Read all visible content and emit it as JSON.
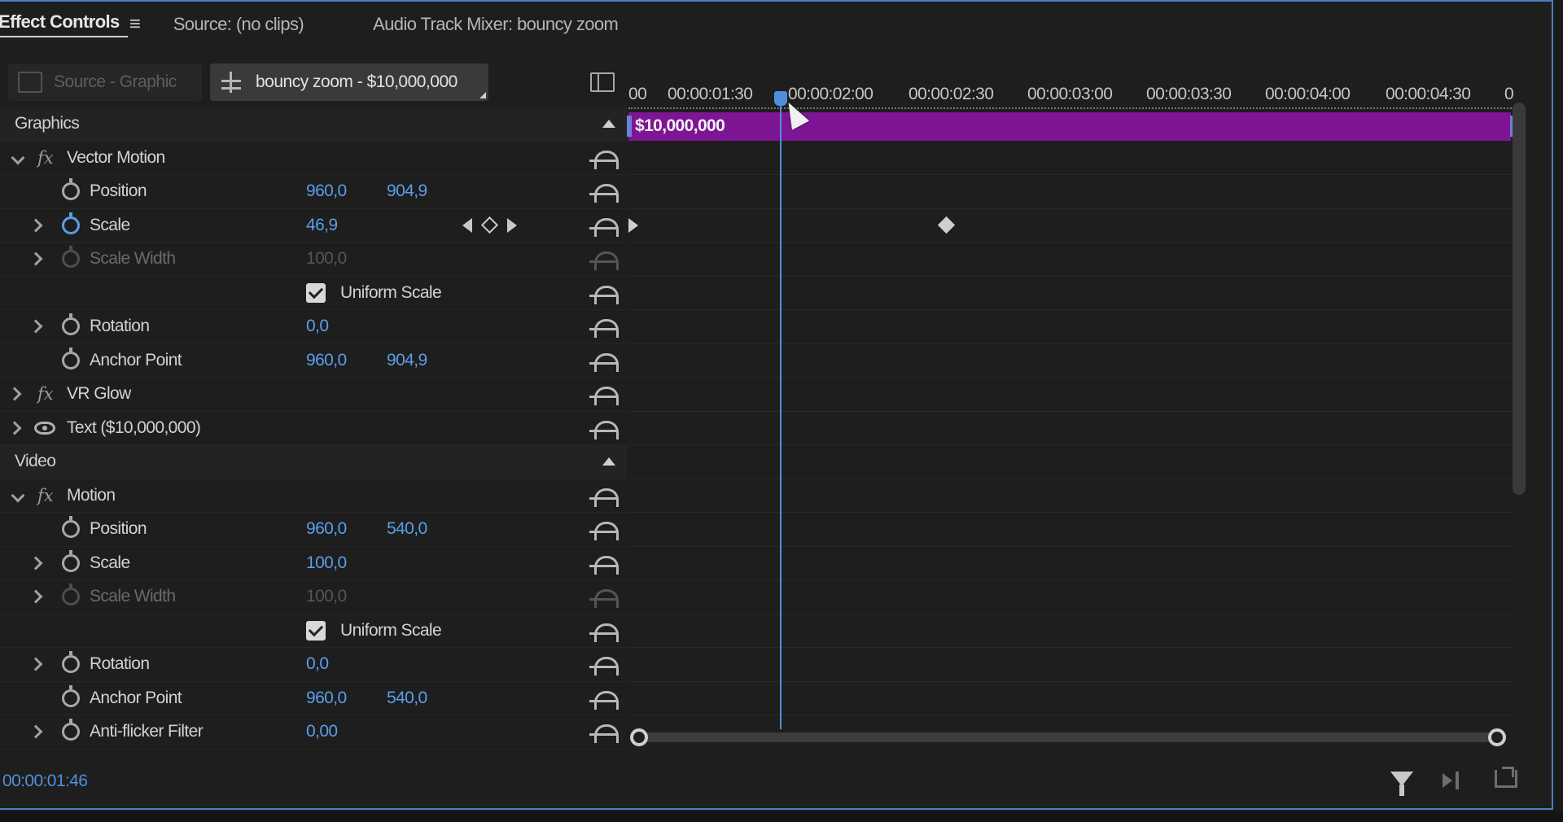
{
  "tabs": {
    "effect_controls": "Effect Controls",
    "source": "Source: (no clips)",
    "audio_mixer": "Audio Track Mixer: bouncy zoom"
  },
  "clip_selector": {
    "source": "Source - Graphic",
    "sequence": "bouncy zoom - $10,000,000"
  },
  "sections": {
    "graphics": "Graphics",
    "video": "Video"
  },
  "graphics": {
    "vector_motion": "Vector Motion",
    "position": {
      "label": "Position",
      "x": "960,0",
      "y": "904,9"
    },
    "scale": {
      "label": "Scale",
      "value": "46,9"
    },
    "scale_width": {
      "label": "Scale Width",
      "value": "100,0"
    },
    "uniform_scale": "Uniform Scale",
    "rotation": {
      "label": "Rotation",
      "value": "0,0"
    },
    "anchor_point": {
      "label": "Anchor Point",
      "x": "960,0",
      "y": "904,9"
    },
    "vr_glow": "VR Glow",
    "text_layer": "Text ($10,000,000)"
  },
  "video": {
    "motion": "Motion",
    "position": {
      "label": "Position",
      "x": "960,0",
      "y": "540,0"
    },
    "scale": {
      "label": "Scale",
      "value": "100,0"
    },
    "scale_width": {
      "label": "Scale Width",
      "value": "100,0"
    },
    "uniform_scale": "Uniform Scale",
    "rotation": {
      "label": "Rotation",
      "value": "0,0"
    },
    "anchor_point": {
      "label": "Anchor Point",
      "x": "960,0",
      "y": "540,0"
    },
    "anti_flicker": {
      "label": "Anti-flicker Filter",
      "value": "0,00"
    }
  },
  "timeline": {
    "ruler": [
      "00",
      "00:00:01:30",
      "00:00:02:00",
      "00:00:02:30",
      "00:00:03:00",
      "00:00:03:30",
      "00:00:04:00",
      "00:00:04:30",
      "0"
    ],
    "clip_label": "$10,000,000"
  },
  "timecode": "00:00:01:46",
  "colors": {
    "accent_blue": "#5a9ee8",
    "clip_purple": "#7e1594"
  },
  "icons": [
    "menu-icon",
    "graphic-icon",
    "sequence-icon",
    "panel-toggle-icon",
    "stopwatch-icon",
    "reset-icon",
    "eye-icon",
    "filter-icon",
    "play-audio-icon",
    "export-icon"
  ]
}
